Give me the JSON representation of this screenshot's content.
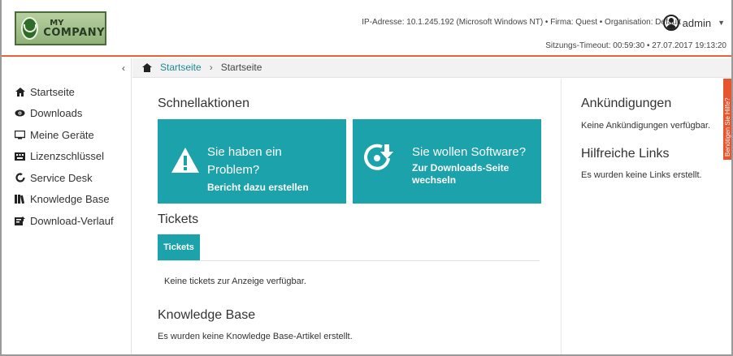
{
  "logo": {
    "line1": "MY",
    "line2": "COMPANY"
  },
  "header": {
    "info": "IP-Adresse: 10.1.245.192 (Microsoft Windows NT) • Firma: Quest • Organisation: Default",
    "user": "admin",
    "timeout": "Sitzungs-Timeout: 00:59:30 • 27.07.2017 19:13:20"
  },
  "sidebar": {
    "collapse": "‹",
    "items": [
      {
        "label": "Startseite",
        "icon": "home-icon"
      },
      {
        "label": "Downloads",
        "icon": "eye-icon"
      },
      {
        "label": "Meine Geräte",
        "icon": "monitor-icon"
      },
      {
        "label": "Lizenzschlüssel",
        "icon": "keyboard-icon"
      },
      {
        "label": "Service Desk",
        "icon": "refresh-icon"
      },
      {
        "label": "Knowledge Base",
        "icon": "books-icon"
      },
      {
        "label": "Download-Verlauf",
        "icon": "history-icon"
      }
    ]
  },
  "breadcrumb": {
    "link": "Startseite",
    "sep": "›",
    "current": "Startseite"
  },
  "main": {
    "quick_actions_title": "Schnellaktionen",
    "tile1": {
      "title": "Sie haben ein Problem?",
      "subtitle": "Bericht dazu erstellen",
      "icon": "warning-icon"
    },
    "tile2": {
      "title": "Sie wollen Software?",
      "subtitle": "Zur Downloads-Seite wechseln",
      "icon": "download-icon"
    },
    "tickets_title": "Tickets",
    "tickets_tab": "Tickets",
    "tickets_empty": "Keine tickets zur Anzeige verfügbar.",
    "kb_title": "Knowledge Base",
    "kb_empty": "Es wurden keine Knowledge Base-Artikel erstellt."
  },
  "right": {
    "ann_title": "Ankündigungen",
    "ann_empty": "Keine Ankündigungen verfügbar.",
    "links_title": "Hilfreiche Links",
    "links_empty": "Es wurden keine Links erstellt."
  },
  "feedback": "Benötigen Sie Hilfe?",
  "colors": {
    "accent": "#1ba2ab",
    "header_line": "#e8623a",
    "feedback": "#e8542e"
  }
}
